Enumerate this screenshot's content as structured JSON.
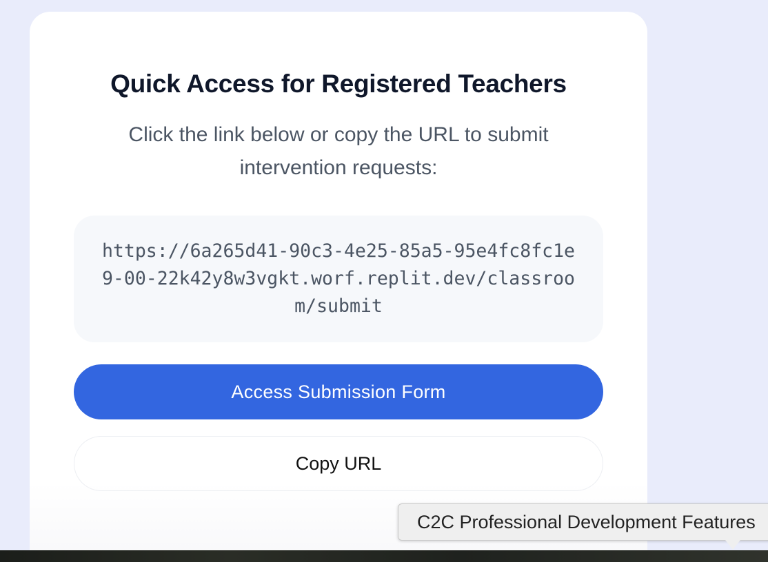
{
  "card": {
    "title": "Quick Access for Registered Teachers",
    "subtitle": "Click the link below or copy the URL to submit intervention requests:",
    "url": "https://6a265d41-90c3-4e25-85a5-95e4fc8fc1e9-00-22k42y8w3vgkt.worf.replit.dev/classroom/submit",
    "primary_button_label": "Access Submission Form",
    "secondary_button_label": "Copy URL"
  },
  "tooltip": {
    "text": "C2C Professional Development Features"
  },
  "colors": {
    "background": "#e9ecfb",
    "card": "#ffffff",
    "primary_button": "#3366e0",
    "url_box": "#f6f8fb"
  }
}
